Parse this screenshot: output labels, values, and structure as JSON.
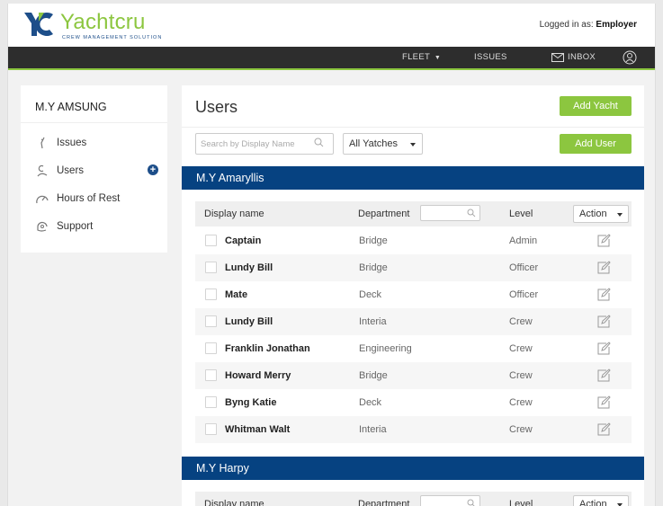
{
  "header": {
    "brand_name": "Yachtcru",
    "brand_tagline": "CREW MANAGEMENT SOLUTION",
    "login_prefix": "Logged in as:",
    "login_user": "Employer",
    "brand_color": "#8cc63f",
    "brand_navy": "#1d4e89"
  },
  "nav": {
    "fleet": "FLEET",
    "issues": "ISSUES",
    "inbox": "INBOX",
    "icons": {
      "fleet": "caret-down-icon",
      "inbox": "envelope-icon",
      "user": "user-circle-icon"
    }
  },
  "sidebar": {
    "title": "M.Y AMSUNG",
    "items": [
      {
        "label": "Issues",
        "icon": "wrench-icon"
      },
      {
        "label": "Users",
        "icon": "user-icon",
        "badge": "+"
      },
      {
        "label": "Hours of Rest",
        "icon": "gauge-icon"
      },
      {
        "label": "Support",
        "icon": "headset-icon"
      }
    ]
  },
  "main": {
    "title": "Users",
    "add_yacht": "Add Yacht",
    "add_user": "Add User",
    "search_placeholder": "Search by Display Name",
    "yacht_filter": "All Yatches",
    "columns": {
      "name": "Display name",
      "department": "Department",
      "level": "Level",
      "action": "Action"
    },
    "yachts": [
      {
        "name": "M.Y Amaryllis",
        "users": [
          {
            "name": "Captain",
            "department": "Bridge",
            "level": "Admin"
          },
          {
            "name": "Lundy Bill",
            "department": "Bridge",
            "level": "Officer"
          },
          {
            "name": "Mate",
            "department": "Deck",
            "level": "Officer"
          },
          {
            "name": "Lundy Bill",
            "department": "Interia",
            "level": "Crew"
          },
          {
            "name": "Franklin Jonathan",
            "department": "Engineering",
            "level": "Crew"
          },
          {
            "name": "Howard Merry",
            "department": "Bridge",
            "level": "Crew"
          },
          {
            "name": "Byng Katie",
            "department": "Deck",
            "level": "Crew"
          },
          {
            "name": "Whitman Walt",
            "department": "Interia",
            "level": "Crew"
          }
        ]
      },
      {
        "name": "M.Y Harpy",
        "users": []
      }
    ],
    "colors": {
      "yacht_bar": "#064281",
      "button": "#8cc63f"
    }
  }
}
